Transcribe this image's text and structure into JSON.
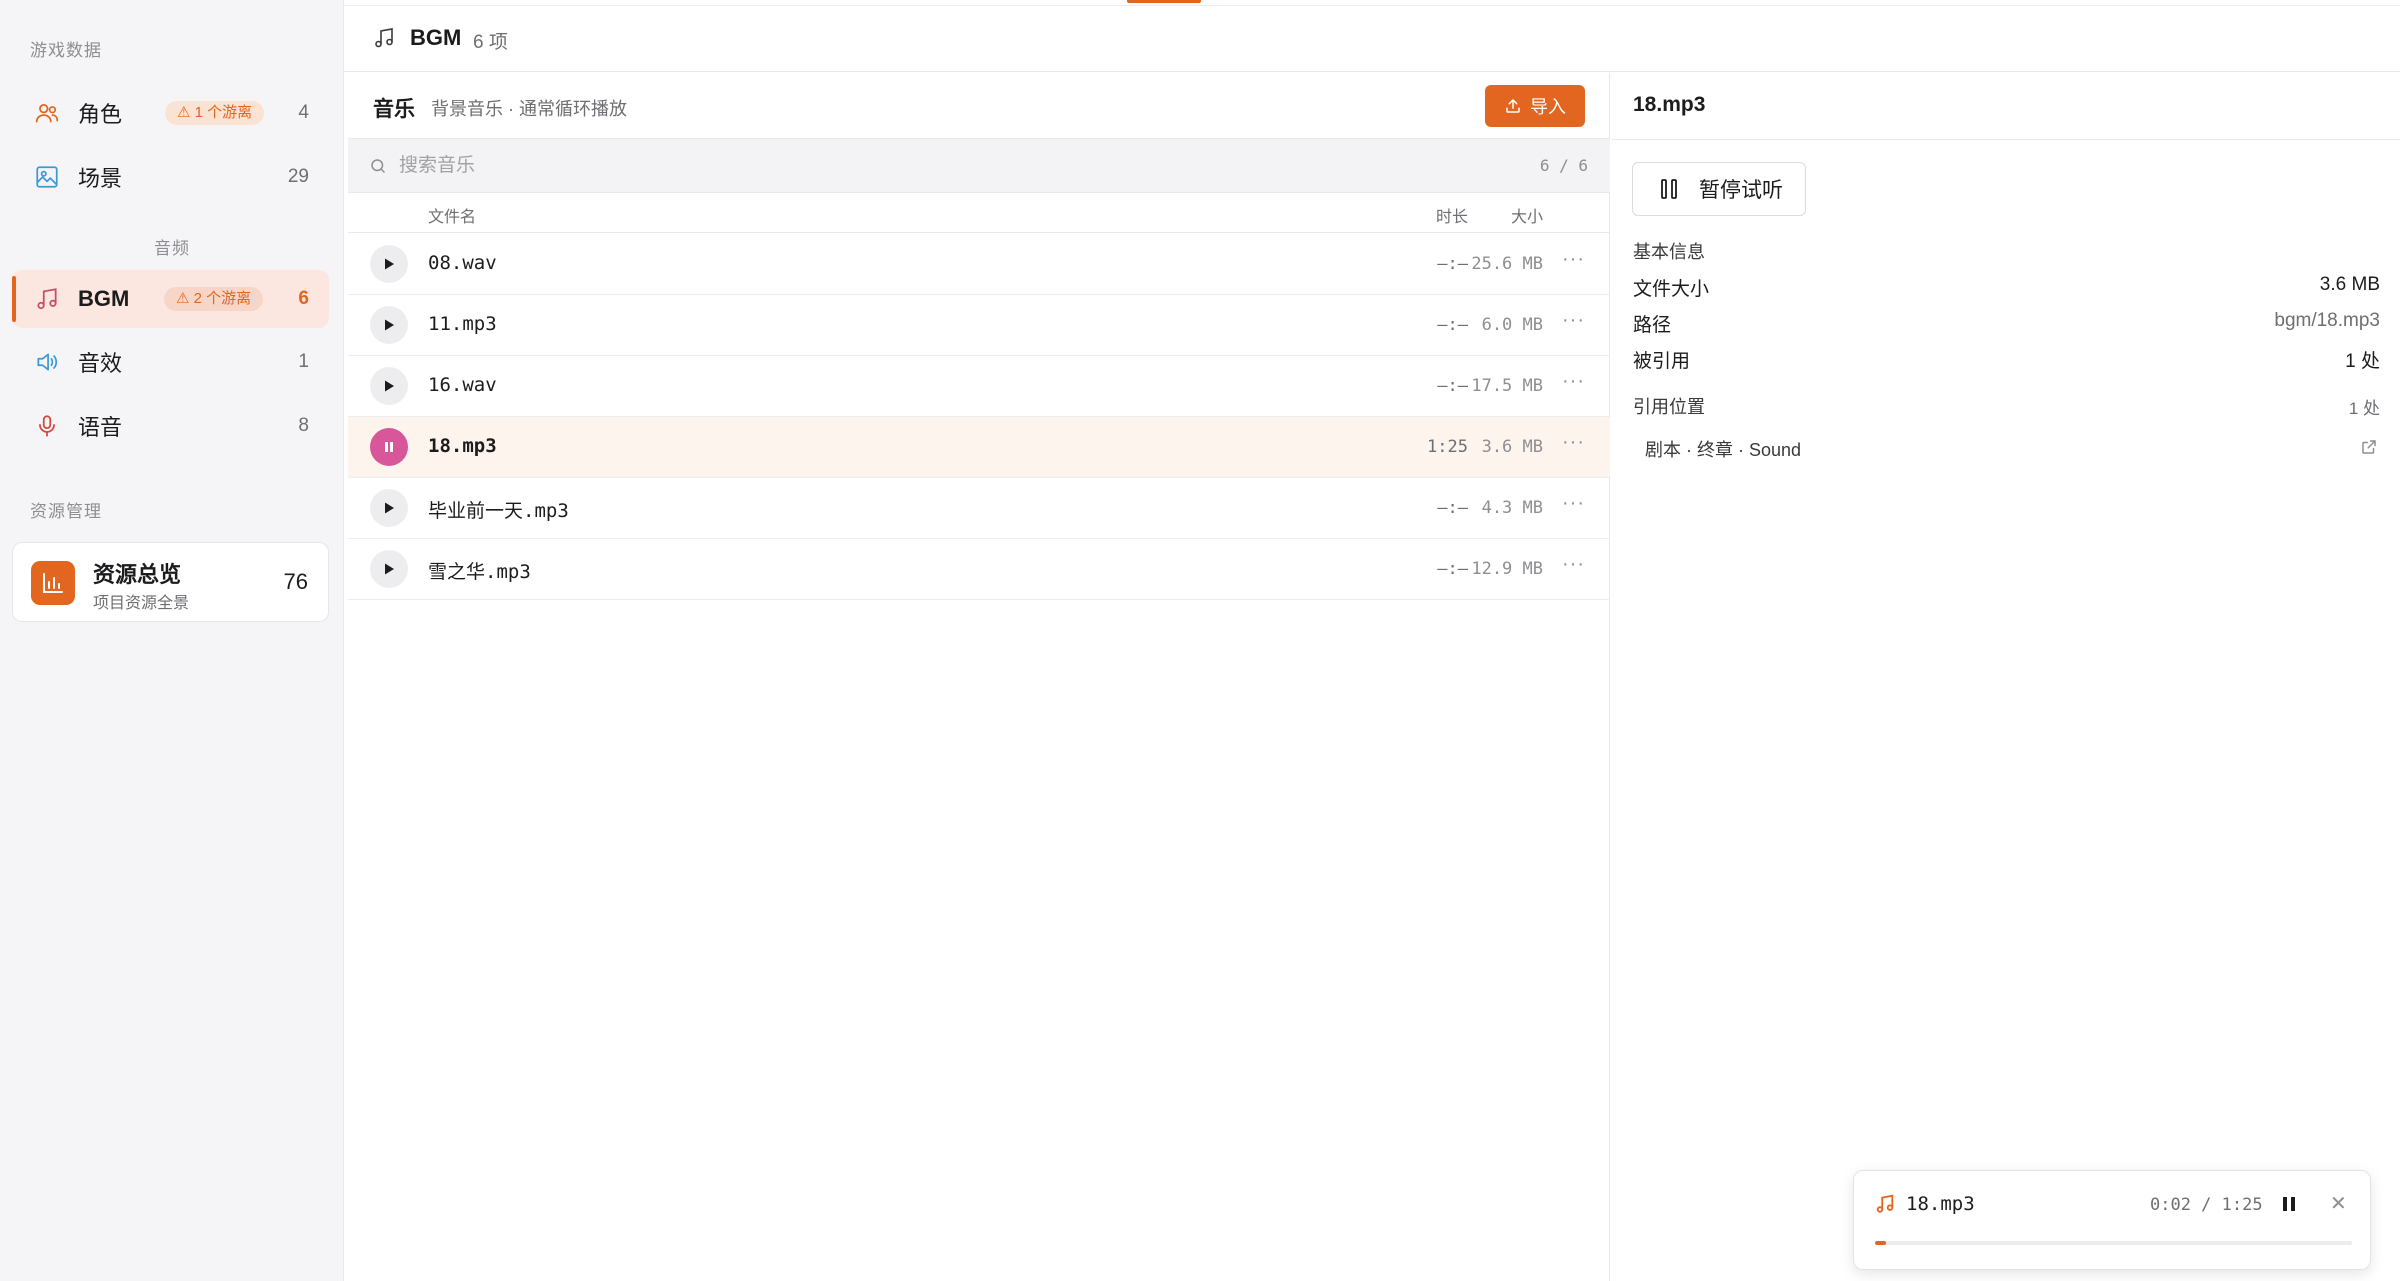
{
  "sidebar": {
    "section_game": "游戏数据",
    "section_audio": "音频",
    "section_manage": "资源管理",
    "items": [
      {
        "label": "角色",
        "badge": "⚠ 1 个游离",
        "count": "4",
        "icon": "users-icon"
      },
      {
        "label": "场景",
        "badge": "",
        "count": "29",
        "icon": "image-icon"
      },
      {
        "label": "BGM",
        "badge": "⚠ 2 个游离",
        "count": "6",
        "icon": "music-note-icon",
        "active": true
      },
      {
        "label": "音效",
        "badge": "",
        "count": "1",
        "icon": "speaker-icon"
      },
      {
        "label": "语音",
        "badge": "",
        "count": "8",
        "icon": "microphone-icon"
      }
    ],
    "overview": {
      "title": "资源总览",
      "subtitle": "项目资源全景",
      "count": "76",
      "icon": "bar-chart-icon"
    }
  },
  "header": {
    "title": "BGM",
    "count": "6 项",
    "icon": "music-note-icon"
  },
  "list": {
    "title": "音乐",
    "subtitle": "背景音乐 · 通常循环播放",
    "import_label": "导入",
    "search_placeholder": "搜索音乐",
    "search_count": "6 / 6",
    "columns": {
      "name": "文件名",
      "duration": "时长",
      "size": "大小"
    },
    "rows": [
      {
        "name": "08.wav",
        "duration": "—:—",
        "size": "25.6 MB"
      },
      {
        "name": "11.mp3",
        "duration": "—:—",
        "size": "6.0 MB"
      },
      {
        "name": "16.wav",
        "duration": "—:—",
        "size": "17.5 MB"
      },
      {
        "name": "18.mp3",
        "duration": "1:25",
        "size": "3.6 MB",
        "playing": true
      },
      {
        "name": "毕业前一天.mp3",
        "duration": "—:—",
        "size": "4.3 MB"
      },
      {
        "name": "雪之华.mp3",
        "duration": "—:—",
        "size": "12.9 MB"
      }
    ]
  },
  "detail": {
    "title": "18.mp3",
    "pause_label": "暂停试听",
    "basic_info": "基本信息",
    "file_size_label": "文件大小",
    "file_size": "3.6 MB",
    "path_label": "路径",
    "path": "bgm/18.mp3",
    "referenced_label": "被引用",
    "referenced": "1 处",
    "ref_location_label": "引用位置",
    "ref_location_count": "1 处",
    "ref_item": "剧本 · 终章 · Sound"
  },
  "player": {
    "name": "18.mp3",
    "time": "0:02 / 1:25",
    "progress": 0.024
  },
  "colors": {
    "accent": "#e2661f",
    "playing": "#d8579a"
  }
}
